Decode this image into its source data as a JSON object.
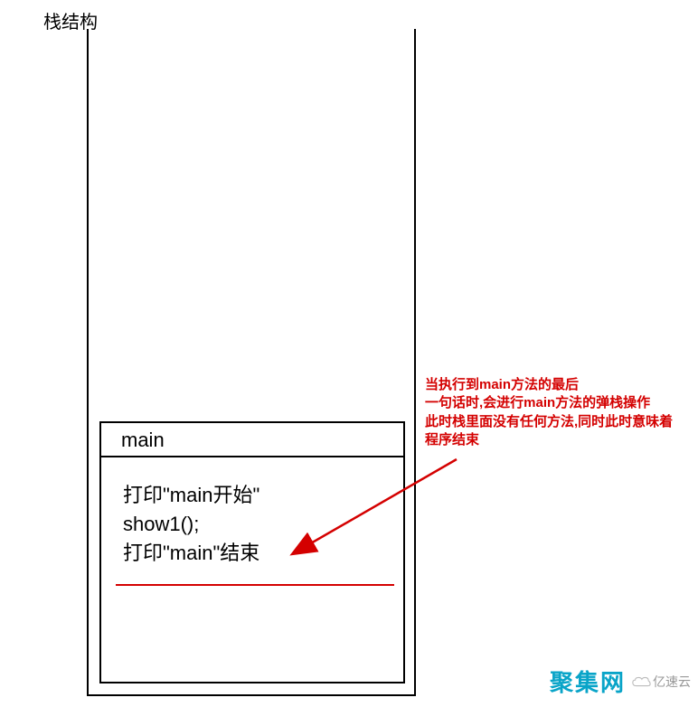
{
  "title": "栈结构",
  "frame": {
    "name": "main",
    "lines": [
      "打印\"main开始\"",
      "show1();",
      "打印\"main\"结束"
    ]
  },
  "annotation": {
    "line1": "当执行到main方法的最后",
    "line2": "一句话时,会进行main方法的弹栈操作",
    "line3": "此时栈里面没有任何方法,同时此时意味着",
    "line4": "程序结束"
  },
  "watermark": {
    "main": "聚集网",
    "sub": "亿速云"
  },
  "colors": {
    "annotation": "#d40000",
    "watermark": "#09a4c8"
  }
}
